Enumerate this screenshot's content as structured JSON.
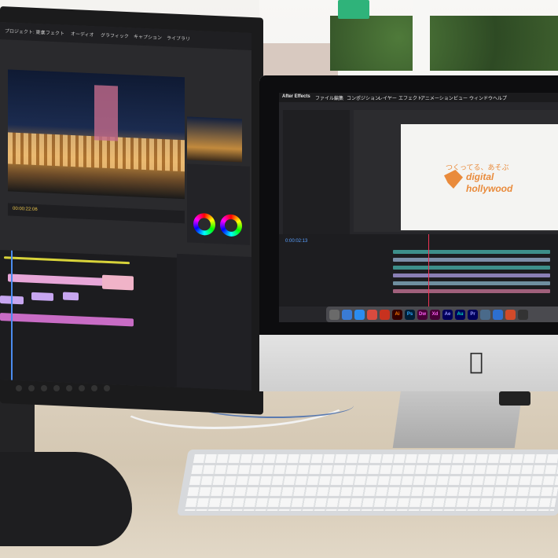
{
  "scene": {
    "left_monitor": {
      "app": "Premiere Pro",
      "menu_items": [
        "プロジェクト: 東京",
        "エフェクト",
        "オーディオ",
        "グラフィック",
        "キャプション",
        "ライブラリ"
      ],
      "timecode": "00:00:22:06",
      "clip_colors": [
        "#e7a6d8",
        "#c7a6f0",
        "#f0b3c8",
        "#c86cc5"
      ]
    },
    "imac": {
      "menu_items": [
        "After Effects",
        "ファイル",
        "編集",
        "コンポジション",
        "レイヤー",
        "エフェクト",
        "アニメーション",
        "ビュー",
        "ウィンドウ",
        "ヘルプ"
      ],
      "canvas_logo_tagline": "つくってる、あそぶ",
      "canvas_logo_line1": "digital",
      "canvas_logo_line2": "hollywood",
      "logo_color": "#e98b3c",
      "timecode": "0:00:02:13",
      "dock_apps": [
        {
          "label": "Ai",
          "color": "#ff7b00",
          "bg": "#330000"
        },
        {
          "label": "Ps",
          "color": "#31a8ff",
          "bg": "#001e36"
        },
        {
          "label": "Dw",
          "color": "#ff61f6",
          "bg": "#470137"
        },
        {
          "label": "Xd",
          "color": "#ff61f6",
          "bg": "#470137"
        },
        {
          "label": "Ae",
          "color": "#9999ff",
          "bg": "#00005b"
        },
        {
          "label": "Au",
          "color": "#00e4bb",
          "bg": "#00005b"
        },
        {
          "label": "Pr",
          "color": "#9999ff",
          "bg": "#00005b"
        }
      ]
    },
    "apple_logo": ""
  }
}
